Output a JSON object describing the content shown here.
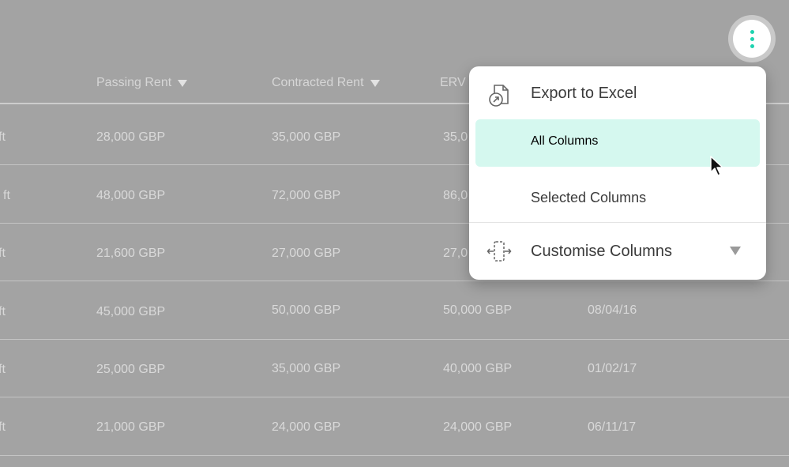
{
  "table": {
    "columns": [
      {
        "label": "Passing Rent",
        "sortable": true
      },
      {
        "label": "Contracted Rent",
        "sortable": true
      },
      {
        "label": "ERV",
        "sortable": false
      }
    ],
    "rows": [
      {
        "area_fragment": "ft",
        "passing": "28,000 GBP",
        "contracted": "35,000 GBP",
        "erv": "35,0",
        "date": ""
      },
      {
        "area_fragment": "j ft",
        "passing": "48,000 GBP",
        "contracted": "72,000 GBP",
        "erv": "86,0",
        "date": ""
      },
      {
        "area_fragment": "ft",
        "passing": "21,600 GBP",
        "contracted": "27,000 GBP",
        "erv": "27,0",
        "date": ""
      },
      {
        "area_fragment": "ft",
        "passing": "45,000 GBP",
        "contracted": "50,000 GBP",
        "erv": "50,000 GBP",
        "date": "08/04/16"
      },
      {
        "area_fragment": "ft",
        "passing": "25,000 GBP",
        "contracted": "35,000 GBP",
        "erv": "40,000 GBP",
        "date": "01/02/17"
      },
      {
        "area_fragment": "ft",
        "passing": "21,000 GBP",
        "contracted": "24,000 GBP",
        "erv": "24,000 GBP",
        "date": "06/11/17"
      }
    ]
  },
  "menu": {
    "export_label": "Export to Excel",
    "all_columns_label": "All Columns",
    "selected_columns_label": "Selected Columns",
    "customise_label": "Customise Columns"
  },
  "icons": {
    "more_button": "more-vertical-icon",
    "export": "export-file-icon",
    "customise": "columns-move-icon",
    "expand": "triangle-down-icon"
  },
  "colors": {
    "accent": "#1fd3b0",
    "highlight": "#d5f8ef",
    "overlay": "#a3a3a3"
  }
}
